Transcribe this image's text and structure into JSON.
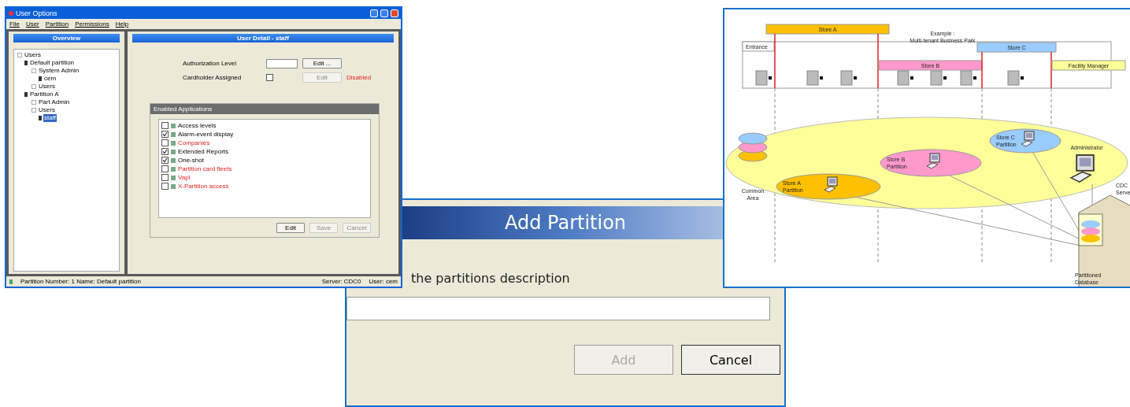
{
  "user_options_window": {
    "title": "User Options",
    "menu": [
      "File",
      "User",
      "Partition",
      "Permissions",
      "Help"
    ],
    "overview": {
      "title": "Overview",
      "tree": [
        {
          "label": "Users",
          "kind": "folder",
          "selected": false,
          "children": [
            {
              "label": "Default partition",
              "kind": "partition",
              "selected": false,
              "children": [
                {
                  "label": "System Admin",
                  "kind": "folder",
                  "selected": false,
                  "children": [
                    {
                      "label": "cem",
                      "kind": "user",
                      "selected": false
                    }
                  ]
                },
                {
                  "label": "Users",
                  "kind": "folder",
                  "selected": false
                }
              ]
            },
            {
              "label": "Partition A",
              "kind": "partition",
              "selected": false,
              "children": [
                {
                  "label": "Part Admin",
                  "kind": "folder",
                  "selected": false
                },
                {
                  "label": "Users",
                  "kind": "folder",
                  "selected": false,
                  "children": [
                    {
                      "label": "staff",
                      "kind": "user",
                      "selected": true
                    }
                  ]
                }
              ]
            }
          ]
        }
      ]
    },
    "detail": {
      "title": "User Detail - staff",
      "fields": [
        {
          "label": "Authorization Level",
          "kind": "text",
          "button": "Edit ...",
          "button_disabled": false
        },
        {
          "label": "Cardholder Assigned",
          "kind": "checkbox",
          "checked": false,
          "button": "Edit",
          "button_disabled": true,
          "status": "Disabled"
        }
      ],
      "applications": {
        "title": "Enabled Applications",
        "items": [
          {
            "label": "Access levels",
            "checked": false,
            "available": true
          },
          {
            "label": "Alarm-event display",
            "checked": true,
            "available": true
          },
          {
            "label": "Companies",
            "checked": false,
            "available": false
          },
          {
            "label": "Extended Reports",
            "checked": true,
            "available": true
          },
          {
            "label": "One-shot",
            "checked": true,
            "available": true
          },
          {
            "label": "Partition card fleets",
            "checked": false,
            "available": false
          },
          {
            "label": "Vapi",
            "checked": false,
            "available": false
          },
          {
            "label": "X-Partition access",
            "checked": false,
            "available": false
          }
        ],
        "buttons": [
          {
            "label": "Edit",
            "disabled": false
          },
          {
            "label": "Save",
            "disabled": true
          },
          {
            "label": "Cancel",
            "disabled": true
          }
        ]
      }
    },
    "status_bar": {
      "partition": "Partition Number: 1  Name: Default partition",
      "server": "Server: CDC0",
      "user": "User: cem"
    }
  },
  "add_partition_dialog": {
    "title": "Add Partition",
    "prompt": "the partitions description",
    "buttons": [
      {
        "label": "Add",
        "disabled": true
      },
      {
        "label": "Cancel",
        "disabled": false
      }
    ]
  },
  "diagram": {
    "title_lines": [
      "Example :",
      "Multi-tenant Business Park"
    ],
    "entrance": "Entrance",
    "zones": [
      {
        "label": "Store A",
        "color": "#ffc000"
      },
      {
        "label": "Store B",
        "color": "#ff99cc"
      },
      {
        "label": "Store C",
        "color": "#99ccff"
      },
      {
        "label": "Facility Manager",
        "color": "#ffff99"
      }
    ],
    "partitions": [
      {
        "lines": [
          "Store A",
          "Partition"
        ],
        "color": "#ffc000"
      },
      {
        "lines": [
          "Store B",
          "Partition"
        ],
        "color": "#ff99cc"
      },
      {
        "lines": [
          "Store C",
          "Partition"
        ],
        "color": "#99ccff"
      }
    ],
    "common_area": [
      "Common",
      "Area"
    ],
    "administrator": "Administrator",
    "server": [
      "CDC",
      "Serve"
    ],
    "database": [
      "Partitioned",
      "Database"
    ]
  }
}
